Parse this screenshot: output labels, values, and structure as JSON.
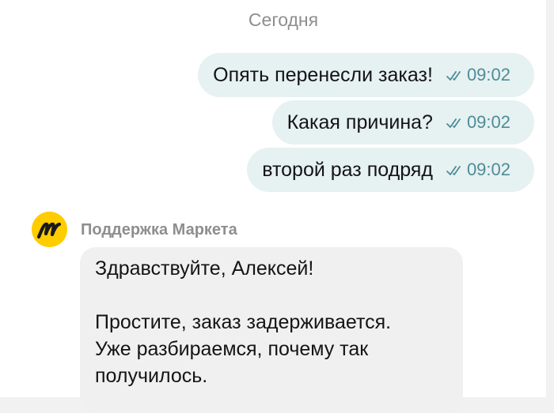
{
  "chat": {
    "date_separator": "Сегодня",
    "outgoing": [
      {
        "text": "Опять перенесли заказ!",
        "time": "09:02",
        "status_icon": "double-check-icon"
      },
      {
        "text": "Какая причина?",
        "time": "09:02",
        "status_icon": "double-check-icon"
      },
      {
        "text": "второй раз подряд",
        "time": "09:02",
        "status_icon": "double-check-icon"
      }
    ],
    "incoming": {
      "sender": "Поддержка Маркета",
      "avatar_icon": "yandex-market-logo",
      "paragraph_1": "Здравствуйте, Алексей!",
      "line_2": "Простите, заказ задерживается.",
      "line_3": "Уже разбираемся, почему так",
      "line_4": "получилось."
    }
  },
  "colors": {
    "outgoing_bubble": "#e6f1f1",
    "incoming_bubble": "#f0f0f0",
    "time_accent": "#4d8c98",
    "avatar_bg": "#ffcc00"
  }
}
